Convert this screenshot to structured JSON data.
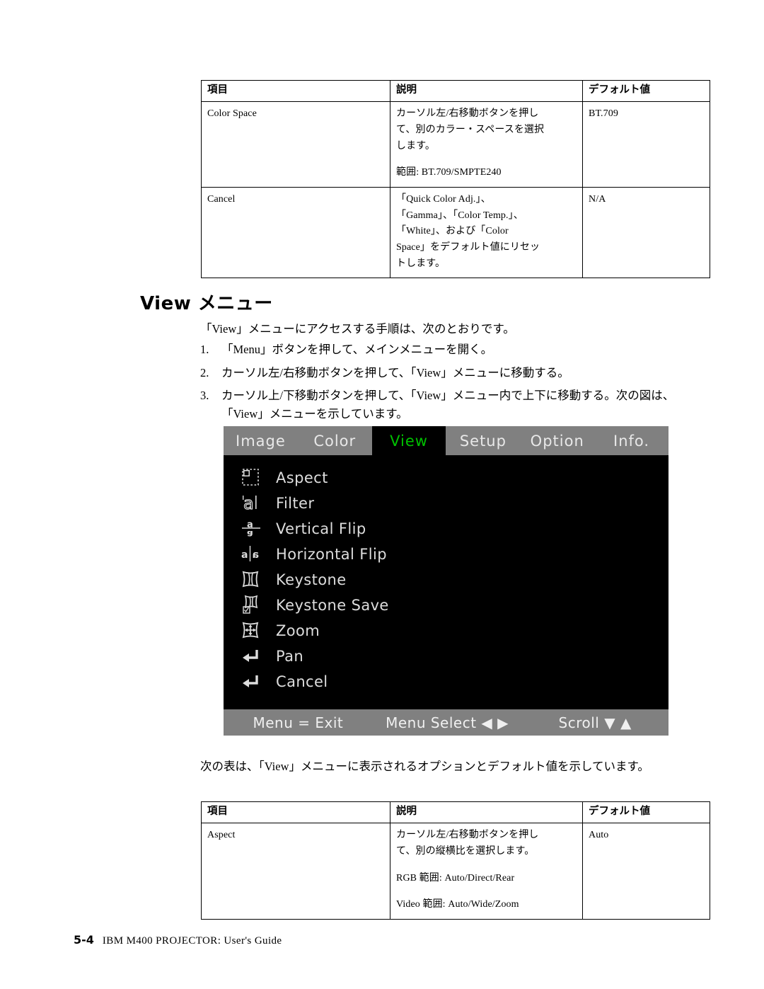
{
  "page": {
    "footer_page_number": "5-4",
    "footer_title": "IBM M400 PROJECTOR: User's Guide"
  },
  "table_top": {
    "headers": {
      "item": "項目",
      "description": "説明",
      "default": "デフォルト値"
    },
    "rows": [
      {
        "item": "Color Space",
        "desc_lines": [
          "カーソル左/右移動ボタンを押し",
          "て、別のカラー・スペースを選択",
          "します。"
        ],
        "desc_extra": "範囲: BT.709/SMPTE240",
        "default": "BT.709"
      },
      {
        "item": "Cancel",
        "desc_lines": [
          "「Quick Color Adj.」、",
          "「Gamma」、「Color Temp.」、",
          "「White」、および「Color",
          "Space」をデフォルト値にリセッ",
          "トします。"
        ],
        "desc_extra": "",
        "default": "N/A"
      }
    ]
  },
  "section": {
    "heading": "View メニュー",
    "intro": "「View」メニューにアクセスする手順は、次のとおりです。",
    "steps": [
      {
        "num": "1.",
        "text": "「Menu」ボタンを押して、メインメニューを開く。"
      },
      {
        "num": "2.",
        "text": "カーソル左/右移動ボタンを押して、「View」メニューに移動する。"
      },
      {
        "num": "3.",
        "text": "カーソル上/下移動ボタンを押して、「View」メニュー内で上下に移動する。次の図は、「View」メニューを示しています。"
      }
    ]
  },
  "osd": {
    "tabs": [
      {
        "label": "Image",
        "active": false
      },
      {
        "label": "Color",
        "active": false
      },
      {
        "label": "View",
        "active": true
      },
      {
        "label": "Setup",
        "active": false
      },
      {
        "label": "Option",
        "active": false
      },
      {
        "label": "Info.",
        "active": false
      }
    ],
    "active_tab_color": "#00c000",
    "tabbar_background": "#808080",
    "background": "#000000",
    "text_color": "#dddddd",
    "items": [
      {
        "label": "Aspect",
        "icon": "aspect-icon"
      },
      {
        "label": "Filter",
        "icon": "filter-icon"
      },
      {
        "label": "Vertical Flip",
        "icon": "vertical-flip-icon"
      },
      {
        "label": "Horizontal Flip",
        "icon": "horizontal-flip-icon"
      },
      {
        "label": "Keystone",
        "icon": "keystone-icon"
      },
      {
        "label": "Keystone Save",
        "icon": "keystone-save-icon"
      },
      {
        "label": "Zoom",
        "icon": "zoom-icon"
      },
      {
        "label": "Pan",
        "icon": "enter-arrow-icon"
      },
      {
        "label": "Cancel",
        "icon": "enter-arrow-icon"
      }
    ],
    "statusbar": {
      "left": "Menu = Exit",
      "middle": "Menu Select ◀ ▶",
      "right": "Scroll ▼ ▲"
    }
  },
  "table2_caption": "次の表は、「View」メニューに表示されるオプションとデフォルト値を示しています。",
  "table_bottom": {
    "headers": {
      "item": "項目",
      "description": "説明",
      "default": "デフォルト値"
    },
    "rows": [
      {
        "item": "Aspect",
        "desc_lines": [
          "カーソル左/右移動ボタンを押し",
          "て、別の縦横比を選択します。"
        ],
        "desc_extra1": "RGB 範囲: Auto/Direct/Rear",
        "desc_extra2": "Video 範囲: Auto/Wide/Zoom",
        "default": "Auto"
      }
    ]
  }
}
